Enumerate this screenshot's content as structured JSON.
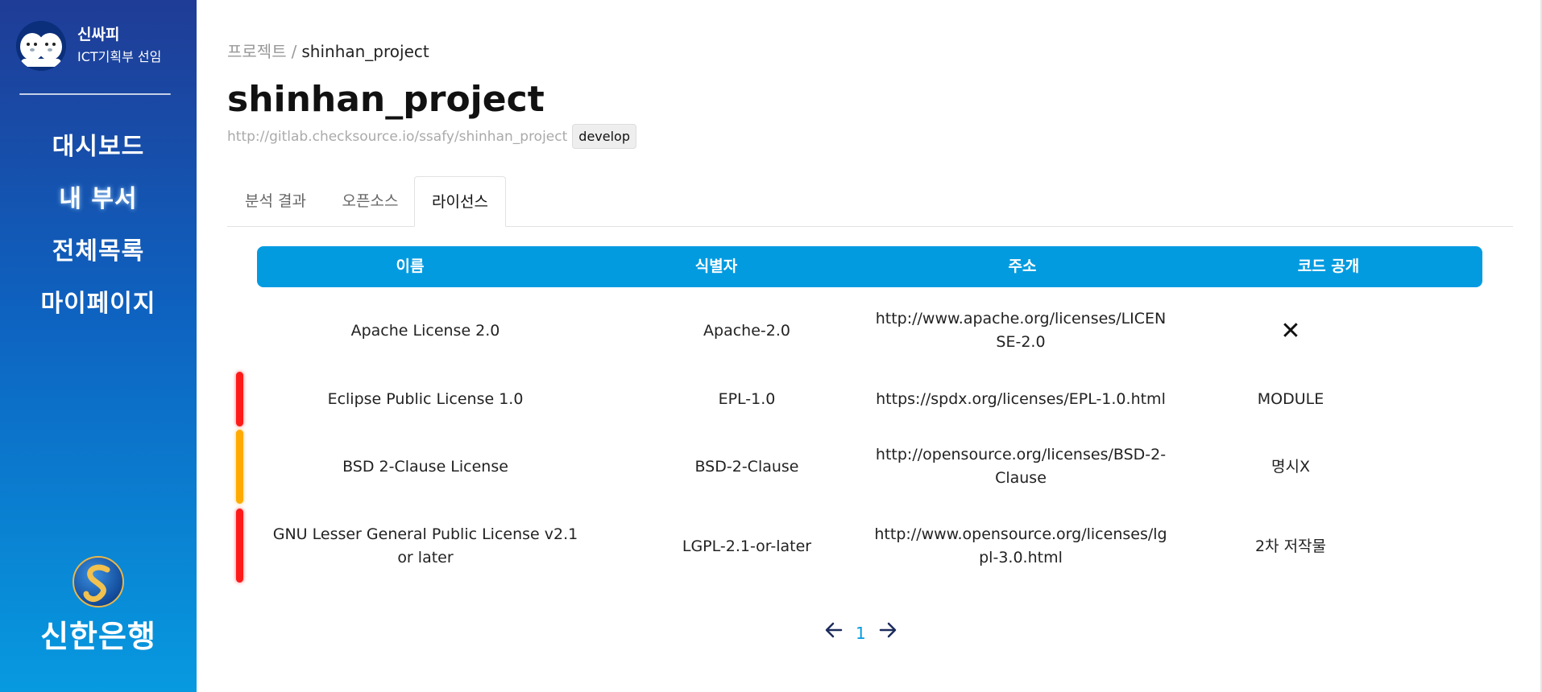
{
  "sidebar": {
    "profile": {
      "name": "신싸피",
      "role": "ICT기획부 선임"
    },
    "nav": [
      {
        "label": "대시보드"
      },
      {
        "label": "내 부서"
      },
      {
        "label": "전체목록"
      },
      {
        "label": "마이페이지"
      }
    ],
    "brand": "신한은행"
  },
  "breadcrumb": {
    "parent": "프로젝트",
    "separator": "/",
    "current": "shinhan_project"
  },
  "project": {
    "title": "shinhan_project",
    "repo_url": "http://gitlab.checksource.io/ssafy/shinhan_project",
    "branch": "develop"
  },
  "tabs": [
    {
      "label": "분석 결과"
    },
    {
      "label": "오픈소스"
    },
    {
      "label": "라이선스",
      "active": true
    }
  ],
  "table": {
    "headers": [
      "이름",
      "식별자",
      "주소",
      "코드 공개"
    ],
    "rows": [
      {
        "name": "Apache License 2.0",
        "id": "Apache-2.0",
        "url": "http://www.apache.org/licenses/LICENSE-2.0",
        "disclosure": "",
        "disclosure_icon": "close-icon",
        "bar_color": ""
      },
      {
        "name": "Eclipse Public License 1.0",
        "id": "EPL-1.0",
        "url": "https://spdx.org/licenses/EPL-1.0.html",
        "disclosure": "MODULE",
        "bar_color": "#ff1a1a"
      },
      {
        "name": "BSD 2-Clause License",
        "id": "BSD-2-Clause",
        "url": "http://opensource.org/licenses/BSD-2-Clause",
        "disclosure": "명시X",
        "bar_color": "#ffaa00"
      },
      {
        "name": "GNU Lesser General Public License v2.1 or later",
        "id": "LGPL-2.1-or-later",
        "url": "http://www.opensource.org/licenses/lgpl-3.0.html",
        "disclosure": "2차 저작물",
        "bar_color": "#ff1a1a"
      }
    ]
  },
  "pagination": {
    "current": "1",
    "prev_icon": "arrow-left-icon",
    "next_icon": "arrow-right-icon"
  },
  "colors": {
    "accent": "#039be0",
    "sidebar_top": "#1f3c96",
    "sidebar_bottom": "#079ae0",
    "risk_high": "#ff1a1a",
    "risk_medium": "#ffaa00"
  }
}
